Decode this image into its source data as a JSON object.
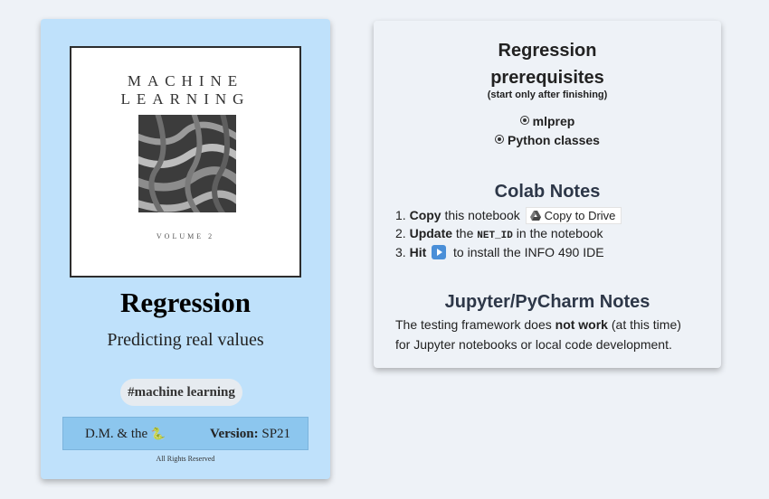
{
  "book": {
    "cover_title_line1": "MACHINE",
    "cover_title_line2": "LEARNING",
    "cover_volume": "VOLUME 2",
    "title": "Regression",
    "subtitle": "Predicting real values",
    "tag": "#machine learning",
    "author": "D.M. & the",
    "author_icon": "snake-icon",
    "version_label": "Version:",
    "version_value": "SP21",
    "rights": "All Rights Reserved"
  },
  "prereqs": {
    "heading_line1": "Regression",
    "heading_line2": "prerequisites",
    "note": "(start only after finishing)",
    "items": [
      "mlprep",
      "Python classes"
    ]
  },
  "colab": {
    "heading": "Colab Notes",
    "step1_num": "1.",
    "step1_bold": "Copy",
    "step1_text": "this notebook",
    "copy_button_label": "Copy to Drive",
    "step2_num": "2.",
    "step2_bold": "Update",
    "step2_text_a": "the",
    "step2_code": "NET_ID",
    "step2_text_b": "in the notebook",
    "step3_num": "3.",
    "step3_bold": "Hit",
    "step3_text": "to install the INFO 490 IDE"
  },
  "jupyter": {
    "heading": "Jupyter/PyCharm Notes",
    "line1_a": "The testing framework does",
    "line1_bold": "not work",
    "line1_b": "(at this time)",
    "line2": "for Jupyter notebooks or local code development."
  },
  "colors": {
    "book_card_bg": "#bfe1fb",
    "footer_bar_bg": "#8cc6ee",
    "page_bg": "#eef2f7",
    "play_button": "#4a8fd8"
  }
}
